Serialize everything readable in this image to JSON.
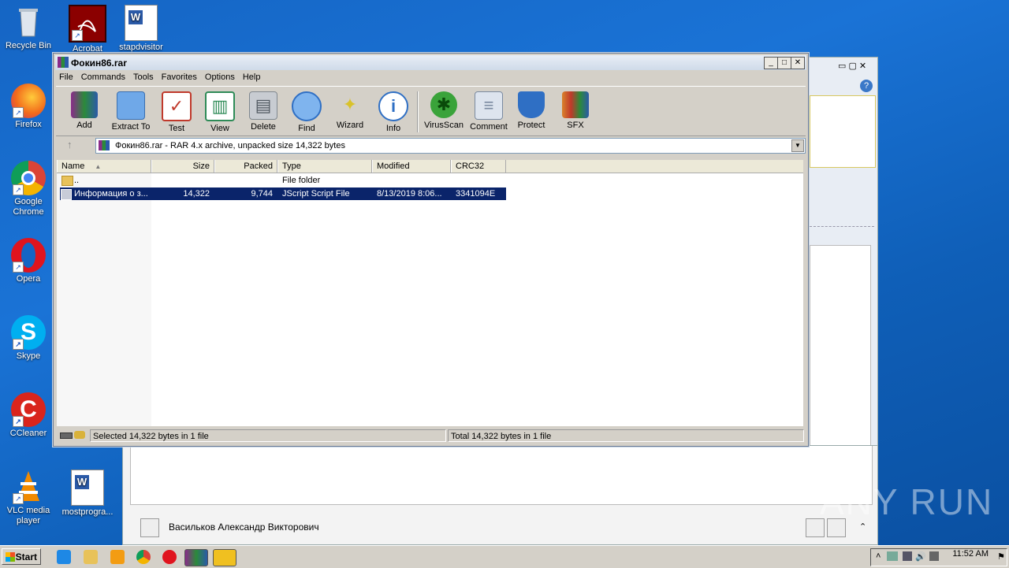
{
  "desktop": {
    "icons": [
      {
        "label": "Recycle Bin"
      },
      {
        "label": "Acrobat"
      },
      {
        "label": "stapdvisitor"
      },
      {
        "label": "Firefox"
      },
      {
        "label": "Google Chrome"
      },
      {
        "label": "Opera"
      },
      {
        "label": "Skype"
      },
      {
        "label": "CCleaner"
      },
      {
        "label": "VLC media player"
      },
      {
        "label": "mostprogra..."
      }
    ],
    "watermark": "ANY RUN"
  },
  "background_window": {
    "footer_name": "Васильков Александр Викторович"
  },
  "winrar": {
    "title": "Фокин86.rar",
    "title_buttons": {
      "minimize": "_",
      "maximize": "□",
      "close": "✕"
    },
    "menu": [
      "File",
      "Commands",
      "Tools",
      "Favorites",
      "Options",
      "Help"
    ],
    "toolbar": [
      {
        "label": "Add",
        "icon": "add-archive-icon",
        "color": "#c0392b"
      },
      {
        "label": "Extract To",
        "icon": "folder-icon",
        "color": "#4a90d9"
      },
      {
        "label": "Test",
        "icon": "clipboard-icon",
        "color": "#c0392b"
      },
      {
        "label": "View",
        "icon": "book-icon",
        "color": "#2e8b57"
      },
      {
        "label": "Delete",
        "icon": "trash-icon",
        "color": "#808890"
      },
      {
        "label": "Find",
        "icon": "magnifier-icon",
        "color": "#2f6fc4"
      },
      {
        "label": "Wizard",
        "icon": "wand-icon",
        "color": "#d9c22a"
      },
      {
        "label": "Info",
        "icon": "info-icon",
        "color": "#2f6fc4"
      },
      {
        "label": "VirusScan",
        "icon": "bug-icon",
        "color": "#3aa33a"
      },
      {
        "label": "Comment",
        "icon": "comment-icon",
        "color": "#7a8aa0"
      },
      {
        "label": "Protect",
        "icon": "shield-icon",
        "color": "#2f6fc4"
      },
      {
        "label": "SFX",
        "icon": "sfx-box-icon",
        "color": "#d9822b"
      }
    ],
    "address": "Фокин86.rar - RAR 4.x archive, unpacked size 14,322 bytes",
    "columns": [
      "Name",
      "Size",
      "Packed",
      "Type",
      "Modified",
      "CRC32"
    ],
    "rows": [
      {
        "name": "..",
        "size": "",
        "packed": "",
        "type": "File folder",
        "modified": "",
        "crc": ""
      },
      {
        "name": "Информация о з...",
        "size": "14,322",
        "packed": "9,744",
        "type": "JScript Script File",
        "modified": "8/13/2019 8:06...",
        "crc": "3341094E"
      }
    ],
    "status_left": "Selected 14,322 bytes in 1 file",
    "status_right": "Total 14,322 bytes in 1 file"
  },
  "taskbar": {
    "start": "Start",
    "clock": "11:52 AM"
  }
}
